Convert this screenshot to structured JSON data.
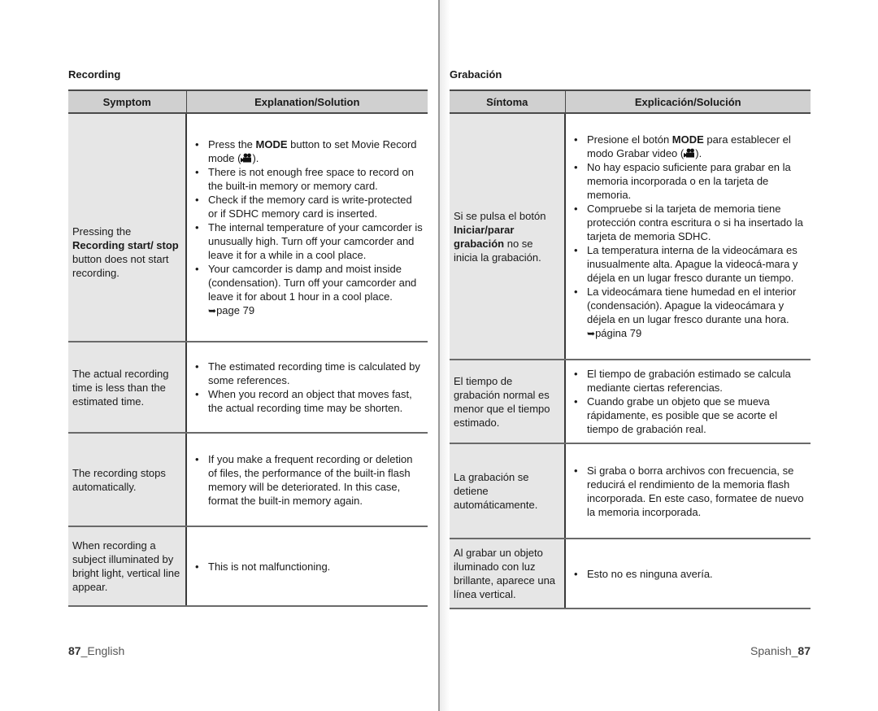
{
  "left_page": {
    "section_title": "Recording",
    "headers": {
      "symptom": "Symptom",
      "explanation": "Explanation/Solution"
    },
    "rows": [
      {
        "symptom_pre": "Pressing the ",
        "symptom_bold": "Recording start/ stop",
        "symptom_post": " button does not start recording.",
        "items": [
          {
            "pre": "Press the ",
            "bold": "MODE",
            "post": " button to set Movie Record  mode (",
            "icon": "movie-camera-icon",
            "after": ")."
          },
          {
            "text": "There is not enough free space to record on the built-in memory or memory card."
          },
          {
            "text": "Check if the memory card is write-protected or if SDHC memory card is inserted."
          },
          {
            "text": "The internal temperature of your camcorder is unusually high. Turn off your camcorder and leave it for a while in a cool place."
          },
          {
            "text": "Your camcorder is damp and moist inside (condensation).  Turn off your camcorder and leave it for about 1 hour in a cool place. ",
            "ref_arrow": "➥",
            "ref": "page 79"
          }
        ]
      },
      {
        "symptom": "The actual recording time is less than the estimated time.",
        "items": [
          {
            "text": "The estimated recording time is calculated by some references."
          },
          {
            "text": "When you record an object that moves fast, the actual recording time may be shorten."
          }
        ]
      },
      {
        "symptom": "The recording stops automatically.",
        "items": [
          {
            "text": "If you make a frequent recording or deletion of files, the performance of the built-in flash memory will be deteriorated. In this case, format the built-in memory again."
          }
        ]
      },
      {
        "symptom": "When recording a subject illuminated by bright light, vertical line appear.",
        "items": [
          {
            "text": "This is not malfunctioning."
          }
        ]
      }
    ],
    "footer": {
      "number": "87",
      "label": "_English"
    }
  },
  "right_page": {
    "section_title": "Grabación",
    "headers": {
      "symptom": "Síntoma",
      "explanation": "Explicación/Solución"
    },
    "rows": [
      {
        "symptom_pre": "Si se pulsa el botón ",
        "symptom_bold": "Iniciar/parar grabación",
        "symptom_post": " no se inicia la grabación.",
        "items": [
          {
            "pre": "Presione el botón ",
            "bold": "MODE",
            "post": " para establecer el modo Grabar video (",
            "icon": "movie-camera-icon",
            "after": ")."
          },
          {
            "text": "No hay espacio suficiente para grabar en la memoria incorporada o en la tarjeta de memoria."
          },
          {
            "text": "Compruebe si la tarjeta de memoria tiene protección contra escritura o si ha insertado la tarjeta de memoria SDHC."
          },
          {
            "text": " La temperatura interna de la videocámara es inusualmente alta. Apague la videocá-mara y déjela en un lugar fresco durante un tiempo."
          },
          {
            "text": "La videocámara tiene humedad en el interior (condensación). Apague la videocámara y déjela en un lugar fresco durante una hora. ",
            "ref_arrow": "➥",
            "ref": "página 79"
          }
        ]
      },
      {
        "symptom": "El tiempo de grabación normal es menor que el tiempo estimado.",
        "items": [
          {
            "text": "El tiempo de grabación estimado se calcula mediante ciertas referencias."
          },
          {
            "text": "Cuando grabe un objeto que se mueva rápidamente, es posible que se acorte el tiempo de grabación real."
          }
        ]
      },
      {
        "symptom": "La grabación se detiene automáticamente.",
        "items": [
          {
            "text": "Si graba o borra archivos con frecuencia, se reducirá el rendimiento de la memoria flash incorporada. En este caso, formatee de nuevo la memoria incorporada."
          }
        ]
      },
      {
        "symptom": "Al grabar un objeto iluminado con luz brillante, aparece una línea vertical.",
        "items": [
          {
            "text": "Esto no es ninguna avería."
          }
        ]
      }
    ],
    "footer": {
      "label": "Spanish_",
      "number": "87"
    }
  }
}
